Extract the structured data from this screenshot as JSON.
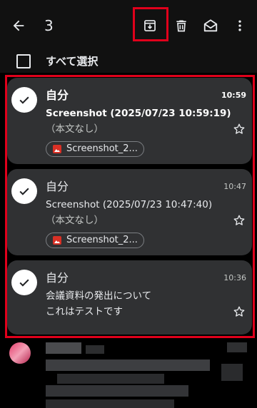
{
  "toolbar": {
    "back_icon": "arrow-left-icon",
    "selected_count": "3",
    "archive_icon": "archive-icon",
    "delete_icon": "trash-icon",
    "mark_read_icon": "envelope-open-icon",
    "more_icon": "more-vertical-icon",
    "highlight_color": "#e0001b"
  },
  "select_all": {
    "label": "すべて選択"
  },
  "emails": [
    {
      "sender": "自分",
      "subject": "Screenshot (2025/07/23 10:59:19)",
      "snippet": "（本文なし）",
      "time": "10:59",
      "unread": true,
      "selected": true,
      "attachment": "Screenshot_2..."
    },
    {
      "sender": "自分",
      "subject": "Screenshot (2025/07/23 10:47:40)",
      "snippet": "（本文なし）",
      "time": "10:47",
      "unread": false,
      "selected": true,
      "attachment": "Screenshot_2..."
    },
    {
      "sender": "自分",
      "subject": "会議資料の発出について",
      "snippet": "これはテストです",
      "time": "10:36",
      "unread": false,
      "selected": true
    }
  ],
  "colors": {
    "card_bg": "#303133",
    "app_bg": "#111111",
    "text": "#e8eaed",
    "attachment_icon": "#d93025"
  }
}
